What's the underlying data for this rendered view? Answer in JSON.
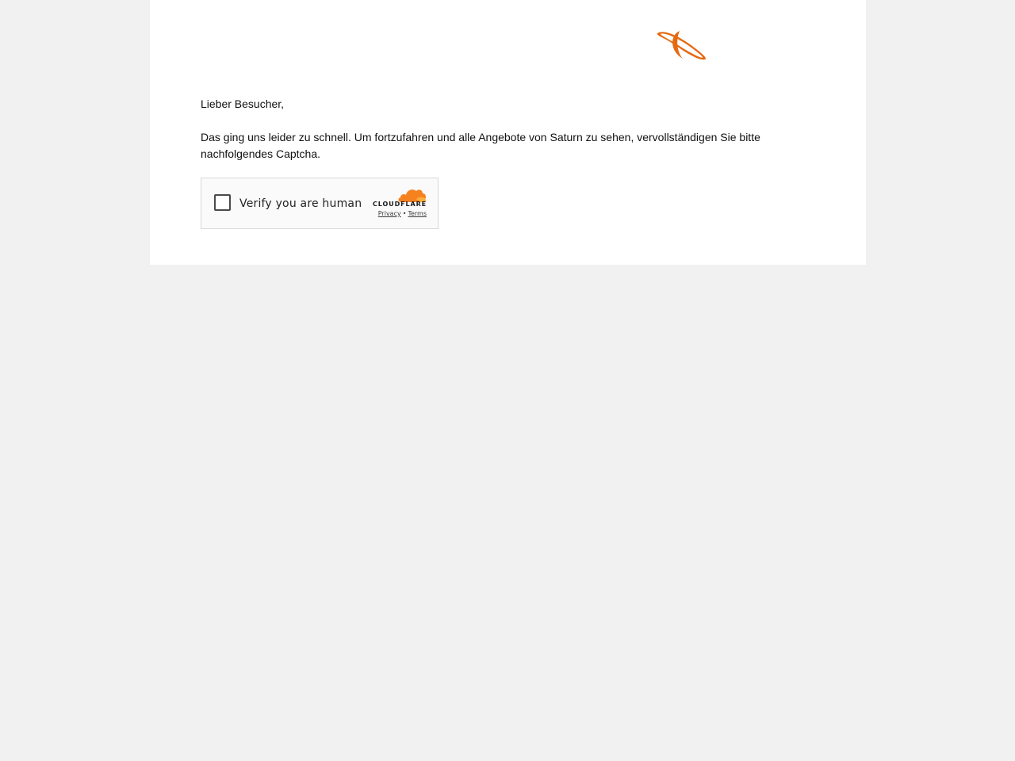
{
  "brand": {
    "logo_icon": "saturn-planet-logo-icon",
    "accent_color": "#e56a12"
  },
  "content": {
    "greeting": "Lieber Besucher,",
    "message": "Das ging uns leider zu schnell. Um fortzufahren und alle Angebote von Saturn zu sehen, vervollständigen Sie bitte nachfolgendes Captcha."
  },
  "captcha": {
    "checkbox_checked": false,
    "label": "Verify you are human",
    "provider_icon": "cloudflare-cloud-icon",
    "provider_name": "CLOUDFLARE",
    "provider_color": "#f38020",
    "privacy_link": "Privacy",
    "separator": "•",
    "terms_link": "Terms"
  }
}
